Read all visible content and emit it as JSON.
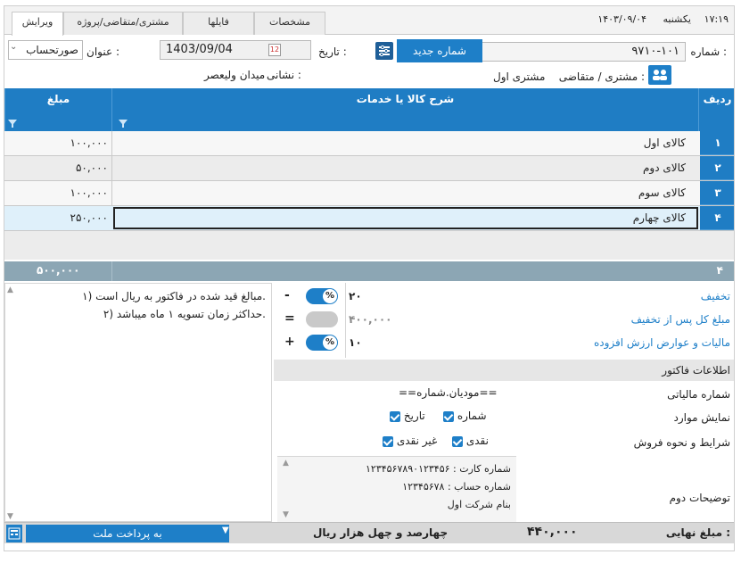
{
  "header": {
    "time": "۱۷:۱۹",
    "weekday": "یکشنبه",
    "date": "۱۴۰۳/۰۹/۰۴",
    "tabs": [
      "ویرایش",
      "مشتری/متقاضی/پروژه",
      "فایلها",
      "مشخصات"
    ]
  },
  "form": {
    "number_label": "شماره :",
    "number_value": "۹۷۱۰-۱۰۱",
    "new_number_label": "شماره جدید",
    "date_label": "تاریخ :",
    "date_value": "1403/09/04",
    "title_label": "عنوان :",
    "title_value": "صورتحساب",
    "customer_label": "مشتری / متقاضی :",
    "customer_value": "مشتری اول",
    "address_label": "نشانی :",
    "address_value": "میدان ولیعصر"
  },
  "grid": {
    "columns": [
      "ردیف",
      "شرح کالا یا خدمات",
      "مبلغ"
    ],
    "rows": [
      {
        "num": "۱",
        "desc": "کالای اول",
        "amount": "۱۰۰,۰۰۰"
      },
      {
        "num": "۲",
        "desc": "کالای دوم",
        "amount": "۵۰,۰۰۰"
      },
      {
        "num": "۳",
        "desc": "کالای سوم",
        "amount": "۱۰۰,۰۰۰"
      },
      {
        "num": "۴",
        "desc": "کالای چهارم",
        "amount": "۲۵۰,۰۰۰"
      }
    ],
    "total_count": "۴",
    "total_amount": "۵۰۰,۰۰۰"
  },
  "notes": {
    "line1": "۱) مبالغ قید شده در فاکتور به ریال است.",
    "line2": "۲) حداکثر زمان تسویه ۱ ماه میباشد."
  },
  "summary": {
    "discount_label": "تخفیف",
    "discount_sign": "-",
    "discount_value": "۲۰",
    "after_discount_label": "مبلغ کل پس از تخفیف",
    "after_discount_sign": "=",
    "after_discount_value": "۴۰۰,۰۰۰",
    "tax_label": "مالیات و عوارض ارزش افزوده",
    "tax_sign": "+",
    "tax_value": "۱۰",
    "percent_symbol": "%"
  },
  "invoice_info": {
    "header": "اطلاعات فاکتور",
    "tax_number_label": "شماره مالیاتی",
    "tax_number_value": "==مودیان.شماره==",
    "show_items_label": "نمایش موارد",
    "show_number": "شماره",
    "show_date": "تاریخ",
    "payment_label": "شرایط و نحوه فروش",
    "pay_cash": "نقدی",
    "pay_noncash": "غیر نقدی",
    "second_desc_label": "توضیحات دوم",
    "card_line": "شماره کارت : ۱۲۳۴۵۶۷۸۹۰۱۲۳۴۵۶",
    "account_line": "شماره حساب : ۱۲۳۴۵۶۷۸",
    "owner_line": "بنام شرکت اول"
  },
  "footer": {
    "final_label": "مبلغ نهایی :",
    "final_value": "۴۴۰,۰۰۰",
    "final_words": "چهارصد و چهل هزار ریال",
    "pay_to": "به پرداخت ملت"
  },
  "colors": {
    "accent": "#1e7fc8",
    "total_bar": "#8ca6b4"
  }
}
